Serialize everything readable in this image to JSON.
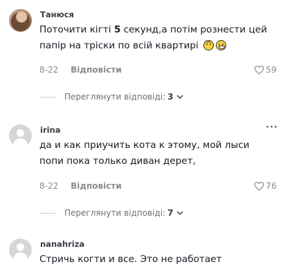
{
  "comments": [
    {
      "username": "Танюся",
      "text": "Поточити кігті ",
      "text_bold": "5",
      "text_rest": " секунд,а потім рознести цей папір на тріски по всій квартирі",
      "emojis": [
        "upside-down-face-emoji",
        "grinning-face-emoji"
      ],
      "date": "8-22",
      "reply_label": "Відповісти",
      "likes": "59",
      "view_replies_label": "Переглянути відповіді:",
      "view_replies_count": "3"
    },
    {
      "username": "irina",
      "text": "да и как приучить кота к этому, мой лыси попи пока только диван дерет,",
      "more": "···",
      "date": "8-22",
      "reply_label": "Відповісти",
      "likes": "76",
      "view_replies_label": "Переглянути відповіді:",
      "view_replies_count": "7"
    },
    {
      "username": "nanahriza",
      "text": "Стричь когти и все. Это не работает"
    }
  ],
  "colors": {
    "text": "#161823",
    "muted": "#8a8b91",
    "divider": "#d0d1d3"
  }
}
